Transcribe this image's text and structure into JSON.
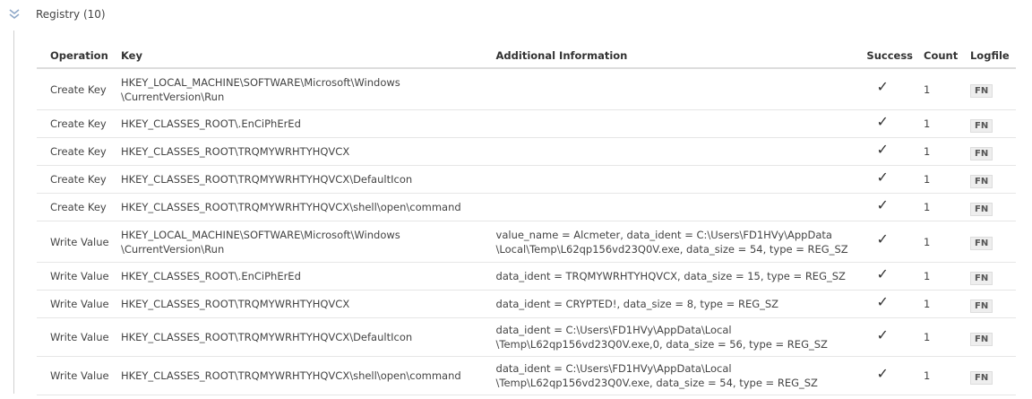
{
  "section": {
    "title": "Registry (10)",
    "icon": "double-chevron-down-icon"
  },
  "table": {
    "headers": {
      "operation": "Operation",
      "key": "Key",
      "info": "Additional Information",
      "success": "Success",
      "count": "Count",
      "logfile": "Logfile"
    },
    "rows": [
      {
        "operation": "Create Key",
        "key": "HKEY_LOCAL_MACHINE\\SOFTWARE\\Microsoft\\Windows\n\\CurrentVersion\\Run",
        "info": "",
        "success": "✓",
        "count": "1",
        "logfile": "FN"
      },
      {
        "operation": "Create Key",
        "key": "HKEY_CLASSES_ROOT\\.EnCiPhErEd",
        "info": "",
        "success": "✓",
        "count": "1",
        "logfile": "FN"
      },
      {
        "operation": "Create Key",
        "key": "HKEY_CLASSES_ROOT\\TRQMYWRHTYHQVCX",
        "info": "",
        "success": "✓",
        "count": "1",
        "logfile": "FN"
      },
      {
        "operation": "Create Key",
        "key": "HKEY_CLASSES_ROOT\\TRQMYWRHTYHQVCX\\DefaultIcon",
        "info": "",
        "success": "✓",
        "count": "1",
        "logfile": "FN"
      },
      {
        "operation": "Create Key",
        "key": "HKEY_CLASSES_ROOT\\TRQMYWRHTYHQVCX\\shell\\open\\command",
        "info": "",
        "success": "✓",
        "count": "1",
        "logfile": "FN"
      },
      {
        "operation": "Write Value",
        "key": "HKEY_LOCAL_MACHINE\\SOFTWARE\\Microsoft\\Windows\n\\CurrentVersion\\Run",
        "info": "value_name = Alcmeter, data_ident = C:\\Users\\FD1HVy\\AppData\n\\Local\\Temp\\L62qp156vd23Q0V.exe, data_size = 54, type = REG_SZ",
        "success": "✓",
        "count": "1",
        "logfile": "FN"
      },
      {
        "operation": "Write Value",
        "key": "HKEY_CLASSES_ROOT\\.EnCiPhErEd",
        "info": "data_ident = TRQMYWRHTYHQVCX, data_size = 15, type = REG_SZ",
        "success": "✓",
        "count": "1",
        "logfile": "FN"
      },
      {
        "operation": "Write Value",
        "key": "HKEY_CLASSES_ROOT\\TRQMYWRHTYHQVCX",
        "info": "data_ident = CRYPTED!, data_size = 8, type = REG_SZ",
        "success": "✓",
        "count": "1",
        "logfile": "FN"
      },
      {
        "operation": "Write Value",
        "key": "HKEY_CLASSES_ROOT\\TRQMYWRHTYHQVCX\\DefaultIcon",
        "info": "data_ident = C:\\Users\\FD1HVy\\AppData\\Local\n\\Temp\\L62qp156vd23Q0V.exe,0, data_size = 56, type = REG_SZ",
        "success": "✓",
        "count": "1",
        "logfile": "FN"
      },
      {
        "operation": "Write Value",
        "key": "HKEY_CLASSES_ROOT\\TRQMYWRHTYHQVCX\\shell\\open\\command",
        "info": "data_ident = C:\\Users\\FD1HVy\\AppData\\Local\n\\Temp\\L62qp156vd23Q0V.exe, data_size = 54, type = REG_SZ",
        "success": "✓",
        "count": "1",
        "logfile": "FN"
      }
    ]
  }
}
